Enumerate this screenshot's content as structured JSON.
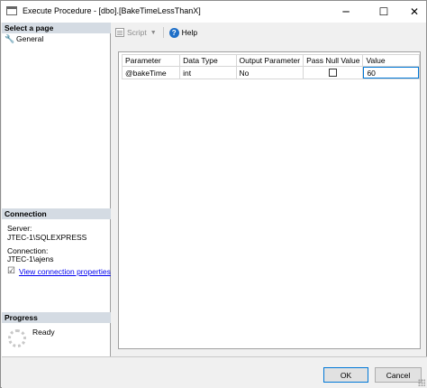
{
  "window": {
    "title": "Execute Procedure - [dbo].[BakeTimeLessThanX]",
    "minimize_glyph": "─",
    "maximize_glyph": "☐",
    "close_glyph": "✕"
  },
  "sidebar": {
    "select_page_header": "Select a page",
    "pages": [
      {
        "label": "General",
        "icon": "wrench-icon"
      }
    ],
    "connection": {
      "header": "Connection",
      "server_label": "Server:",
      "server_value": "JTEC-1\\SQLEXPRESS",
      "connection_label": "Connection:",
      "connection_value": "JTEC-1\\ajens",
      "link_label": "View connection properties"
    },
    "progress": {
      "header": "Progress",
      "status": "Ready"
    }
  },
  "toolbar": {
    "script_label": "Script",
    "help_label": "Help"
  },
  "grid": {
    "columns": [
      "Parameter",
      "Data Type",
      "Output Parameter",
      "Pass Null Value",
      "Value"
    ],
    "rows": [
      {
        "parameter": "@bakeTime",
        "data_type": "int",
        "output_parameter": "No",
        "pass_null": false,
        "value": "60"
      }
    ]
  },
  "footer": {
    "ok_label": "OK",
    "cancel_label": "Cancel"
  },
  "colors": {
    "section_header_bg": "#d4dbe3",
    "accent": "#0078d7",
    "link": "#0000ee"
  }
}
